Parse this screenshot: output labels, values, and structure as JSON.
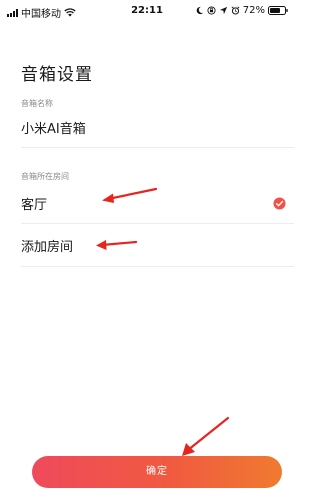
{
  "status_bar": {
    "carrier": "中国移动",
    "time": "22:11",
    "battery": "72%"
  },
  "page": {
    "title": "音箱设置"
  },
  "name_field": {
    "label": "音箱名称",
    "value": "小米AI音箱"
  },
  "room_section": {
    "label": "音箱所在房间",
    "rooms": [
      {
        "label": "客厅",
        "selected": true
      },
      {
        "label": "添加房间",
        "selected": false
      }
    ]
  },
  "confirm_button": {
    "label": "确定"
  },
  "colors": {
    "accent": "#f0514a",
    "arrow": "#e8241f"
  },
  "icons": [
    "signal-icon",
    "wifi-icon",
    "moon-icon",
    "lock-rotation-icon",
    "location-icon",
    "alarm-icon",
    "battery-icon",
    "check-icon"
  ]
}
